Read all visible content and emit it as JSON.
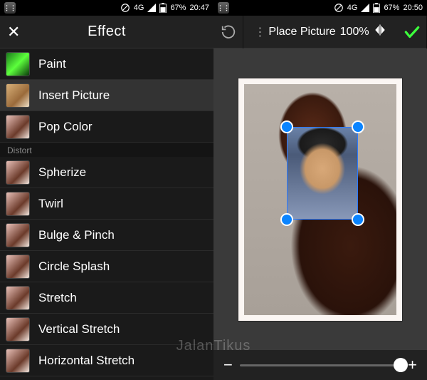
{
  "statusbar_left": {
    "network": "4G",
    "battery": "67%",
    "time": "20:47"
  },
  "statusbar_right": {
    "network": "4G",
    "battery": "67%",
    "time": "20:50"
  },
  "left_panel": {
    "title": "Effect",
    "items": [
      {
        "label": "Paint"
      },
      {
        "label": "Insert Picture"
      },
      {
        "label": "Pop Color"
      }
    ],
    "section": "Distort",
    "distort_items": [
      {
        "label": "Spherize"
      },
      {
        "label": "Twirl"
      },
      {
        "label": "Bulge & Pinch"
      },
      {
        "label": "Circle Splash"
      },
      {
        "label": "Stretch"
      },
      {
        "label": "Vertical Stretch"
      },
      {
        "label": "Horizontal Stretch"
      }
    ]
  },
  "right_panel": {
    "action_label": "Place Picture",
    "zoom": "100%",
    "slider": {
      "minus": "−",
      "plus": "+"
    }
  },
  "watermark": "JalanTikus"
}
